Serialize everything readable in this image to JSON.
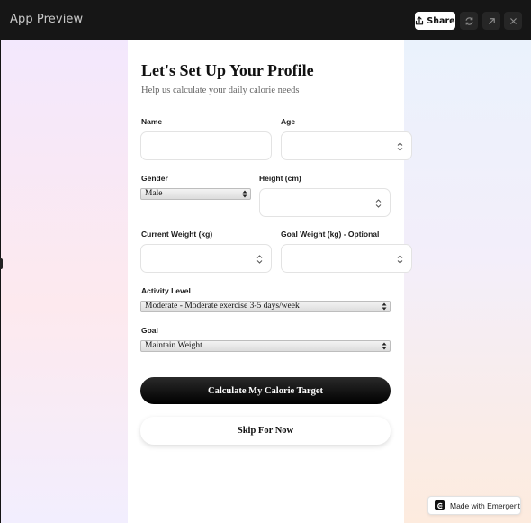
{
  "window": {
    "title": "App Preview",
    "share_label": "Share",
    "icons": [
      "share-icon",
      "refresh-icon",
      "open-external-icon",
      "close-icon"
    ]
  },
  "form": {
    "title": "Let's Set Up Your Profile",
    "subtitle": "Help us calculate your daily calorie needs",
    "name_label": "Name",
    "name_value": "",
    "age_label": "Age",
    "age_value": "",
    "gender_label": "Gender",
    "gender_value": "Male",
    "height_label": "Height (cm)",
    "height_value": "",
    "current_weight_label": "Current Weight (kg)",
    "current_weight_value": "",
    "goal_weight_label": "Goal Weight (kg) - Optional",
    "goal_weight_value": "",
    "activity_label": "Activity Level",
    "activity_value": "Moderate - Moderate exercise 3-5 days/week",
    "goal_label": "Goal",
    "goal_value": "Maintain Weight",
    "calculate_label": "Calculate My Calorie Target",
    "skip_label": "Skip For Now"
  },
  "badge": {
    "label": "Made with Emergent"
  },
  "colors": {
    "topbar": "#161616",
    "primary_button": "#000000",
    "card": "#ffffff"
  }
}
